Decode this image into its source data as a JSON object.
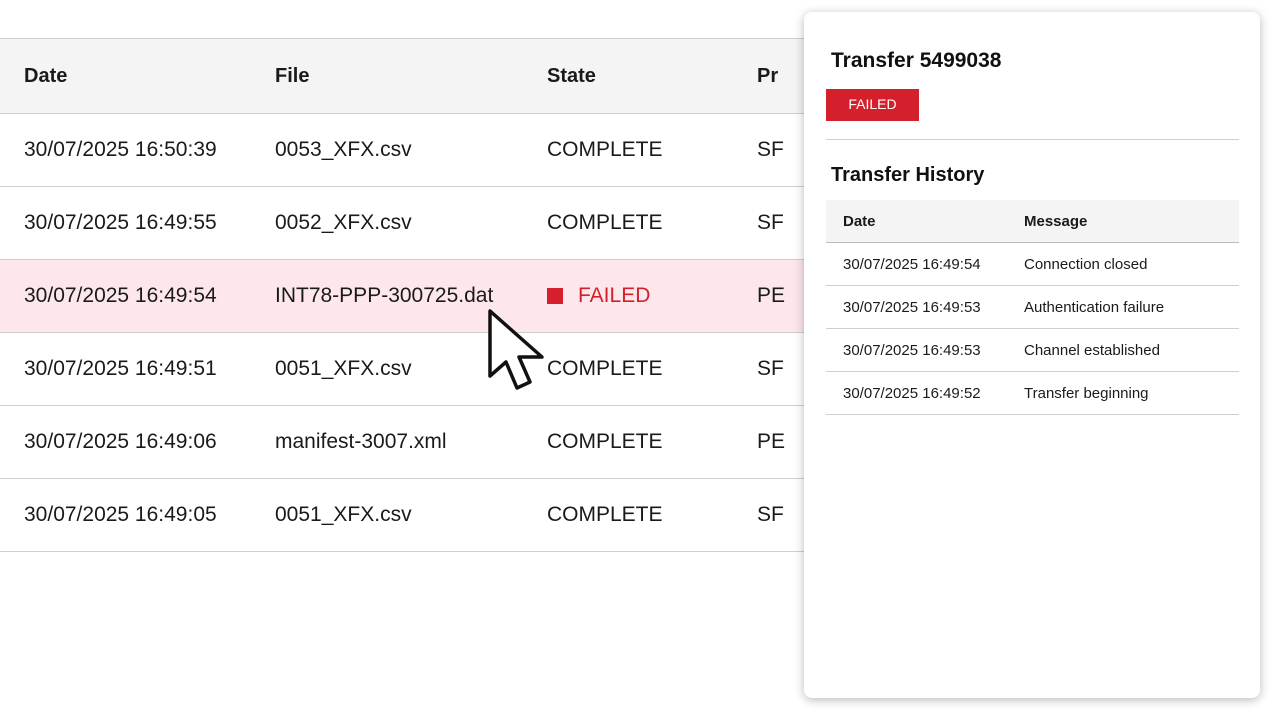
{
  "table": {
    "columns": {
      "date": "Date",
      "file": "File",
      "state": "State",
      "protocol": "Pr"
    },
    "rows": [
      {
        "date": "30/07/2025 16:50:39",
        "file": "0053_XFX.csv",
        "state": "COMPLETE",
        "protocol": "SF"
      },
      {
        "date": "30/07/2025 16:49:55",
        "file": "0052_XFX.csv",
        "state": "COMPLETE",
        "protocol": "SF"
      },
      {
        "date": "30/07/2025 16:49:54",
        "file": "INT78-PPP-300725.dat",
        "state": "FAILED",
        "protocol": "PE"
      },
      {
        "date": "30/07/2025 16:49:51",
        "file": "0051_XFX.csv",
        "state": "COMPLETE",
        "protocol": "SF"
      },
      {
        "date": "30/07/2025 16:49:06",
        "file": "manifest-3007.xml",
        "state": "COMPLETE",
        "protocol": "PE"
      },
      {
        "date": "30/07/2025 16:49:05",
        "file": "0051_XFX.csv",
        "state": "COMPLETE",
        "protocol": "SF"
      }
    ]
  },
  "detail": {
    "title": "Transfer 5499038",
    "status": "FAILED",
    "history_title": "Transfer History",
    "history_columns": {
      "date": "Date",
      "message": "Message"
    },
    "history": [
      {
        "date": "30/07/2025 16:49:54",
        "message": "Connection closed"
      },
      {
        "date": "30/07/2025 16:49:53",
        "message": "Authentication failure"
      },
      {
        "date": "30/07/2025 16:49:53",
        "message": "Channel established"
      },
      {
        "date": "30/07/2025 16:49:52",
        "message": "Transfer beginning"
      }
    ]
  },
  "colors": {
    "failed": "#d4202c",
    "failed_row_bg": "#fde7ea",
    "header_bg": "#f4f4f4"
  },
  "icons": {
    "cursor": "mouse-pointer-icon",
    "status": "failed-square-icon"
  }
}
